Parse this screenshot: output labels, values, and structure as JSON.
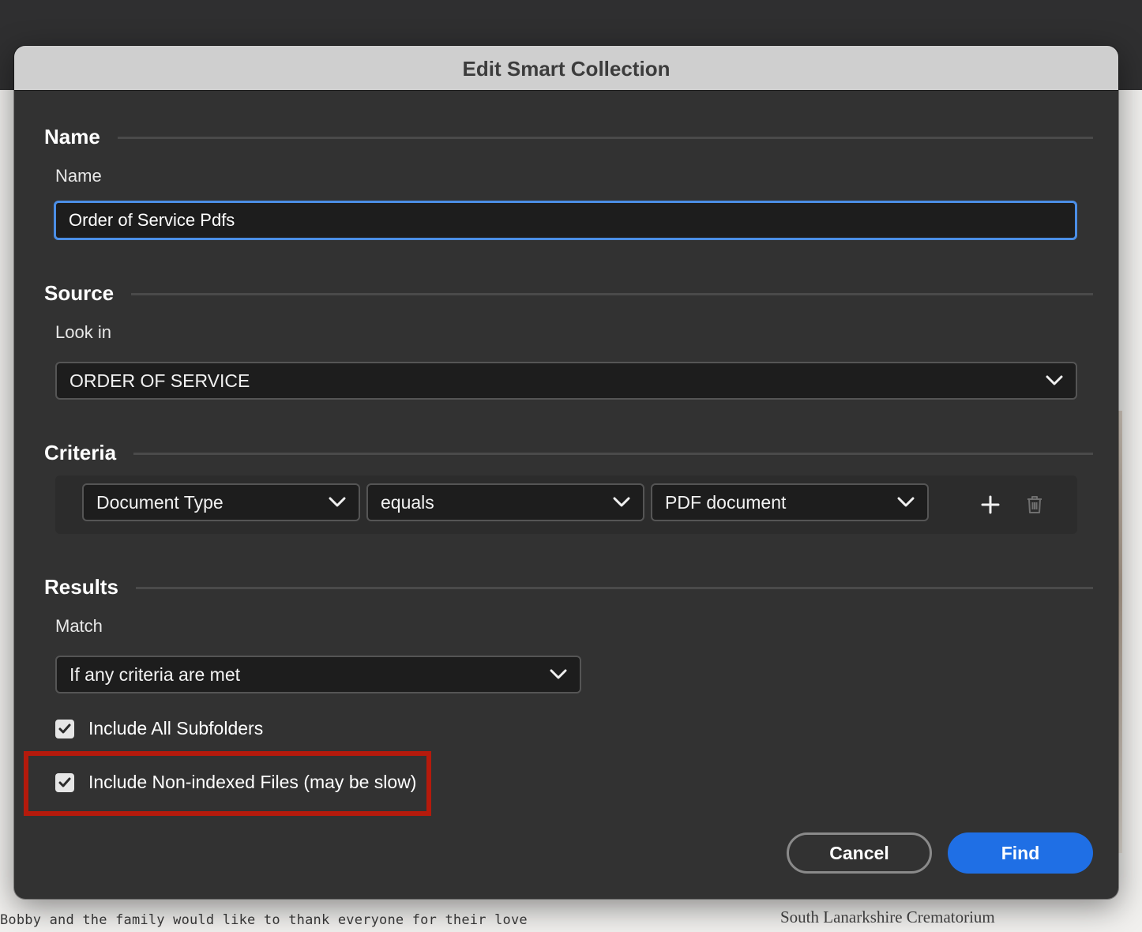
{
  "window": {
    "title": "Edit Smart Collection"
  },
  "sections": {
    "name": {
      "title": "Name",
      "label": "Name",
      "value": "Order of Service Pdfs"
    },
    "source": {
      "title": "Source",
      "label": "Look in",
      "selected": "ORDER OF SERVICE"
    },
    "criteria": {
      "title": "Criteria",
      "rows": [
        {
          "field": "Document Type",
          "operator": "equals",
          "value": "PDF document"
        }
      ],
      "add_icon": "plus-icon",
      "delete_icon": "trash-icon"
    },
    "results": {
      "title": "Results",
      "match_label": "Match",
      "match_selected": "If any criteria are met",
      "checkboxes": [
        {
          "label": "Include All Subfolders",
          "checked": true
        },
        {
          "label": "Include Non-indexed Files (may be slow)",
          "checked": true
        }
      ]
    }
  },
  "buttons": {
    "cancel": "Cancel",
    "find": "Find"
  },
  "background_document": {
    "left_text": "Bobby and the family would like to thank everyone for their love",
    "right_text": "South Lanarkshire Crematorium"
  },
  "colors": {
    "accent": "#1f6fe5",
    "focus_border": "#4b8ee6",
    "highlight": "#b51a0c",
    "dialog_bg": "#323232"
  }
}
